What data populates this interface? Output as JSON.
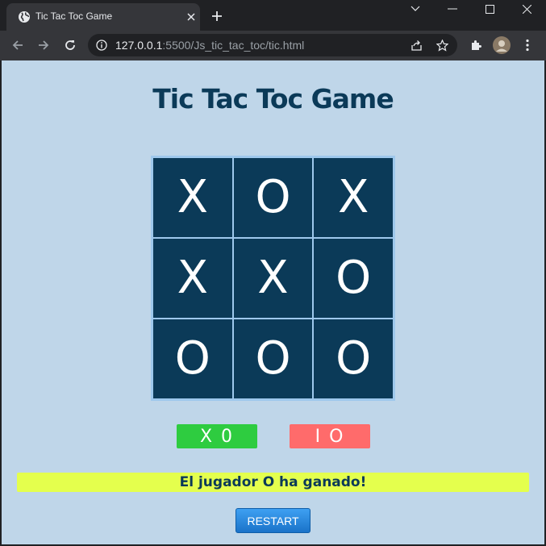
{
  "browser": {
    "tab_title": "Tic Tac Toc Game",
    "url_host": "127.0.0.1",
    "url_path": ":5500/Js_tic_tac_toc/tic.html"
  },
  "page": {
    "title": "Tic Tac Toc Game",
    "board": [
      "X",
      "O",
      "X",
      "X",
      "X",
      "O",
      "O",
      "O",
      "O"
    ],
    "score_x": "X 0",
    "score_o": "I O",
    "status": "El jugador O ha ganado!",
    "restart_label": "RESTART"
  },
  "colors": {
    "page_bg": "#bfd6e9",
    "board_cell": "#0b3a58",
    "score_x_bg": "#2ecc40",
    "score_o_bg": "#ff6b6b",
    "status_bg": "#e4ff4d",
    "restart_bg": "#1a73c9"
  }
}
